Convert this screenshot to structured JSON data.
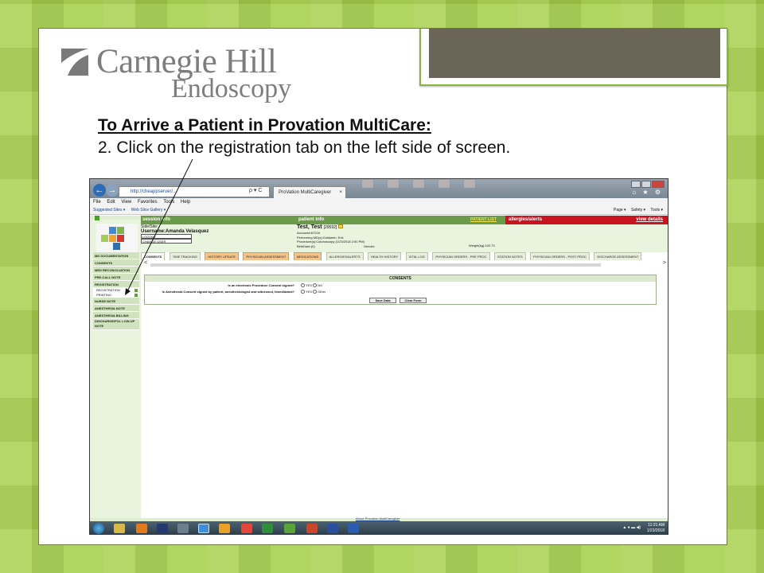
{
  "slide": {
    "logo_name": "Carnegie Hill",
    "logo_sub": "Endoscopy",
    "heading": "To Arrive a Patient in Provation MultiCare:",
    "instruction": "2. Click on the registration tab on the left side of screen."
  },
  "browser": {
    "address": "http://cheappserver/...",
    "address_search": "ρ ▾ C",
    "tab_title": "ProVation MultiCaregiver",
    "tab_close": "×",
    "nav_back": "←",
    "nav_forward": "→",
    "topright_icons": "⌂ ★ ⚙",
    "menu": [
      "File",
      "Edit",
      "View",
      "Favorites",
      "Tools",
      "Help"
    ],
    "favorites": [
      "Suggested Sites ▾",
      "Web Slice Gallery ▾"
    ],
    "commands": [
      "Page ▾",
      "Safety ▾",
      "Tools ▾"
    ]
  },
  "app": {
    "session_header": "session info",
    "patient_header": "patient info",
    "patient_list": "PATIENT LIST",
    "allergies_header": "allergies/alerts",
    "view_details": "view details",
    "session": {
      "site": "Side/Site:",
      "username_label": "Username:",
      "username": "Amanda Velasquez",
      "logout": "LOGOUT",
      "change_user": "CHANGE USER"
    },
    "patient": {
      "name": "Test, Test",
      "mrn": "[29592]",
      "account": "Account#:67216",
      "performing": "Performing MD(s):Goldstein, Eric",
      "procedure": "Procedure(s):Colonoscopy (1/23/2018 2:00 PM)",
      "birthdate": "BirthDate:(0)",
      "gender": "Gender:",
      "weight": "Weight(kg):102.73"
    },
    "sidebar": {
      "items_top": [
        "MD DOCUMENTATION",
        "CONSENTS",
        "MED RECONCILIATION",
        "PRE-CALL NOTE",
        "REGISTRATION"
      ],
      "sub_items": [
        "REGISTRATION",
        "PRINTING"
      ],
      "items_bottom": [
        "NURSE NOTE",
        "ANESTHESIA NOTE",
        "ANESTHESIA BILLING",
        "DISCHARGE/FOL LOW-UP NOTE"
      ]
    },
    "tabs": [
      "CONSENTS",
      "TIME TRACKING",
      "HISTORY UPDATE",
      "PHYSICIAN ASSESSMENT",
      "MEDICATIONS",
      "ALLERGIES/ALERTS",
      "HEALTH HISTORY",
      "VITAL LOG",
      "PHYSICIAN ORDERS - PRE PROC",
      "STATION NOTES",
      "PHYSICIAN ORDERS - POST PROC",
      "DISCHARGE ASSESSMENT"
    ],
    "scroll_left": "<",
    "scroll_right": ">",
    "consents": {
      "title": "CONSENTS",
      "q1": "Is an electronic Procedure Consent signed?",
      "q1_yes": "YES",
      "q1_no": "NO",
      "q2": "Is Anesthesia Consent signed by patient, anesthesiologist and witnessed, timed/dated?",
      "q2_yes": "YES",
      "q2_other": "Other",
      "save": "Save Data",
      "clear": "Clear Form"
    },
    "footer_link": "About Provation MultiCaregiver"
  },
  "taskbar": {
    "time": "11:21 AM",
    "date": "1/23/2018"
  },
  "colors": {
    "background": "#a6cf4b",
    "header_green": "#6b9b4a",
    "alert_red": "#c8141e",
    "tab_orange": "#f3c48c"
  }
}
